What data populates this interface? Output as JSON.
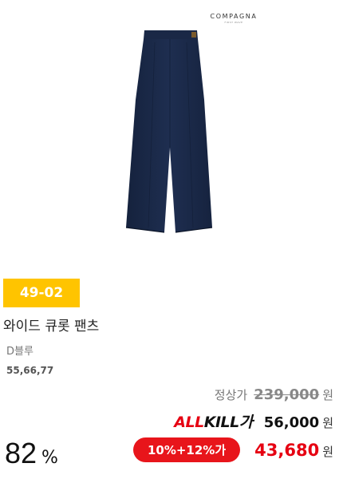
{
  "brand": {
    "name": "COMPAGNA",
    "sub": "FIRST WAVE"
  },
  "product": {
    "code": "49-02",
    "name": "와이드 큐롯 팬츠",
    "color": "D블루",
    "sizes": "55,66,77"
  },
  "pricing": {
    "regular_label": "정상가",
    "regular_price": "239,000",
    "allkill_logo_prefix": "ALL",
    "allkill_logo_mid": "KILL",
    "allkill_logo_suffix": "가",
    "allkill_price": "56,000",
    "coupon_label": "10%+12%가",
    "final_price": "43,680",
    "currency": "원",
    "discount_value": "82",
    "discount_unit": "%"
  },
  "colors": {
    "badge_yellow": "#ffc400",
    "accent_red": "#e60012",
    "pants_navy": "#1b2a48"
  }
}
